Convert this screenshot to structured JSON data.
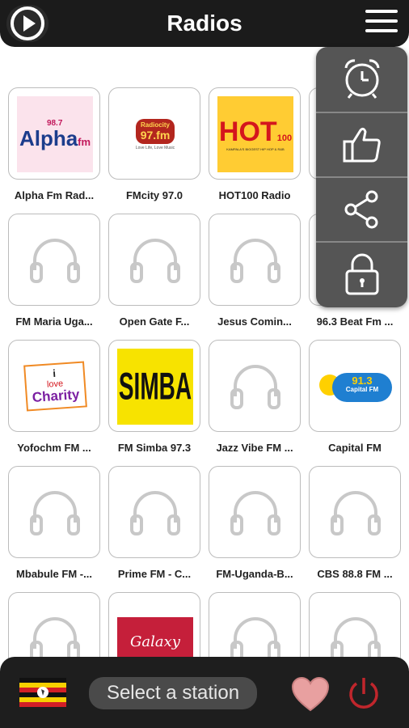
{
  "header": {
    "title": "Radios",
    "play_icon": "play-circle-icon",
    "menu_icon": "hamburger-menu-icon"
  },
  "side_menu": [
    {
      "icon": "alarm-clock-icon"
    },
    {
      "icon": "thumbs-up-icon"
    },
    {
      "icon": "share-icon"
    },
    {
      "icon": "lock-icon"
    }
  ],
  "stations": [
    {
      "label": "Alpha Fm Rad...",
      "logo": "alpha",
      "logo_text": "Alpha",
      "logo_sub": "98.7",
      "logo_fm": "fm"
    },
    {
      "label": "FMcity 97.0",
      "logo": "fmcity",
      "logo_text": "Radiocity",
      "logo_sub": "97.fm",
      "logo_fm": "Love Life, Love Music"
    },
    {
      "label": "HOT100 Radio",
      "logo": "hot",
      "logo_text": "HOT",
      "logo_sub": "100",
      "logo_fm": "KAMPALA'S BIGGEST HIP HOP & R&B"
    },
    {
      "label": "",
      "logo": "none"
    },
    {
      "label": "FM Maria Uga...",
      "logo": "headphones"
    },
    {
      "label": "Open Gate F...",
      "logo": "headphones"
    },
    {
      "label": "Jesus Comin...",
      "logo": "headphones"
    },
    {
      "label": "96.3 Beat Fm ...",
      "logo": "headphones"
    },
    {
      "label": "Yofochm FM ...",
      "logo": "charity",
      "logo_text": "i",
      "logo_sub": "love",
      "logo_fm": "Charity"
    },
    {
      "label": "FM Simba 97.3",
      "logo": "simba",
      "logo_text": "SIMBA"
    },
    {
      "label": "Jazz Vibe FM ...",
      "logo": "headphones"
    },
    {
      "label": "Capital FM",
      "logo": "capital",
      "logo_text": "91.3",
      "logo_sub": "Capital FM"
    },
    {
      "label": "Mbabule FM -...",
      "logo": "headphones"
    },
    {
      "label": "Prime FM - C...",
      "logo": "headphones"
    },
    {
      "label": "FM-Uganda-B...",
      "logo": "headphones"
    },
    {
      "label": "CBS 88.8 FM ...",
      "logo": "headphones"
    },
    {
      "label": "",
      "logo": "headphones"
    },
    {
      "label": "",
      "logo": "galaxy",
      "logo_text": "Galaxy"
    },
    {
      "label": "",
      "logo": "headphones"
    },
    {
      "label": "",
      "logo": "headphones"
    }
  ],
  "bottom": {
    "flag_icon": "uganda-flag-icon",
    "select_label": "Select a station",
    "heart_icon": "heart-icon",
    "power_icon": "power-icon"
  },
  "colors": {
    "header_bg": "#1b1b1b",
    "side_menu_bg": "#555555",
    "power_red": "#c0262c",
    "heart_pink": "#e8a0a0"
  }
}
